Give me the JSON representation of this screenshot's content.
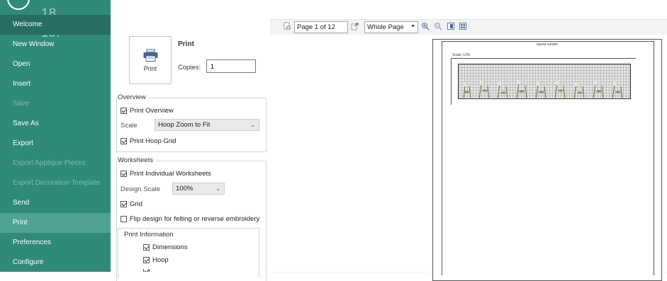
{
  "sidebar": {
    "overlay_numbers": [
      "18.",
      "19."
    ],
    "items": [
      {
        "label": "Welcome",
        "state": "selected"
      },
      {
        "label": "New Window",
        "state": "normal"
      },
      {
        "label": "Open",
        "state": "normal"
      },
      {
        "label": "Insert",
        "state": "normal"
      },
      {
        "label": "Save",
        "state": "disabled"
      },
      {
        "label": "Save As",
        "state": "normal"
      },
      {
        "label": "Export",
        "state": "normal"
      },
      {
        "label": "Export Applique Pieces",
        "state": "disabled"
      },
      {
        "label": "Export Decoration Template",
        "state": "disabled"
      },
      {
        "label": "Send",
        "state": "normal"
      },
      {
        "label": "Print",
        "state": "active"
      },
      {
        "label": "Preferences",
        "state": "normal"
      },
      {
        "label": "Configure",
        "state": "normal"
      }
    ]
  },
  "print": {
    "button_label": "Print",
    "title": "Print",
    "copies_label": "Copies:",
    "copies_value": "1"
  },
  "overview": {
    "title": "Overview",
    "print_overview": {
      "label": "Print Overview",
      "checked": true
    },
    "scale_label": "Scale",
    "scale_value": "Hoop Zoom to Fit",
    "print_hoop_grid": {
      "label": "Print Hoop Grid",
      "checked": true
    }
  },
  "worksheets": {
    "title": "Worksheets",
    "print_individual": {
      "label": "Print Individual Worksheets",
      "checked": true
    },
    "design_scale_label": "Design Scale",
    "design_scale_value": "100%",
    "grid": {
      "label": "Grid",
      "checked": true
    },
    "flip": {
      "label": "Flip design for felting or reverse embroidery",
      "checked": false
    },
    "print_information_title": "Print Information",
    "dimensions": {
      "label": "Dimensions",
      "checked": true
    },
    "hoop": {
      "label": "Hoop",
      "checked": true
    }
  },
  "preview": {
    "page_indicator": "Page 1 of 12",
    "zoom_value": "Whole Page",
    "page_header": "layout curtain",
    "scale_text": "Scale: 11%"
  },
  "colors": {
    "sidebar": "#2f8a79",
    "sidebar_selected": "#4fa392",
    "sidebar_disabled_text": "#7fb8ac"
  },
  "icons": [
    "printer-icon",
    "first-page-icon",
    "export-icon",
    "zoom-in-icon",
    "zoom-out-icon",
    "one-page-icon",
    "multi-page-icon",
    "dropdown-arrow-icon",
    "checkmark-icon",
    "back-icon"
  ]
}
